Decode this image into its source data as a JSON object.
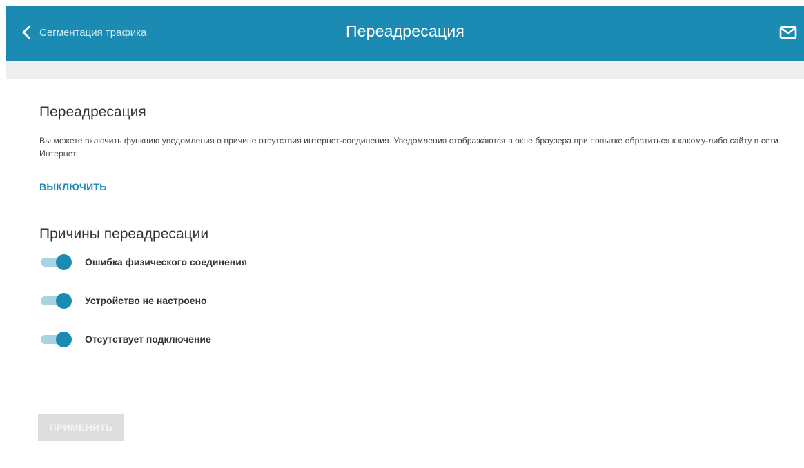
{
  "header": {
    "back_label": "Сегментация трафика",
    "title": "Переадресация",
    "back_icon": "chevron-left-icon",
    "mail_icon": "mail-icon",
    "bg_color": "#1b8bb3"
  },
  "main": {
    "section_title": "Переадресация",
    "description": "Вы можете включить функцию уведомления о причине отсутствия интернет-соединения. Уведомления отображаются в окне браузера при попытке обратиться к какому-либо сайту в сети Интернет.",
    "disable_label": "ВЫКЛЮЧИТЬ",
    "reasons_title": "Причины переадресации",
    "reasons": [
      {
        "label": "Ошибка физического соединения",
        "enabled": true
      },
      {
        "label": "Устройство не настроено",
        "enabled": true
      },
      {
        "label": "Отсутствует подключение",
        "enabled": true
      }
    ],
    "apply_label": "ПРИМЕНИТЬ",
    "apply_disabled": true
  }
}
